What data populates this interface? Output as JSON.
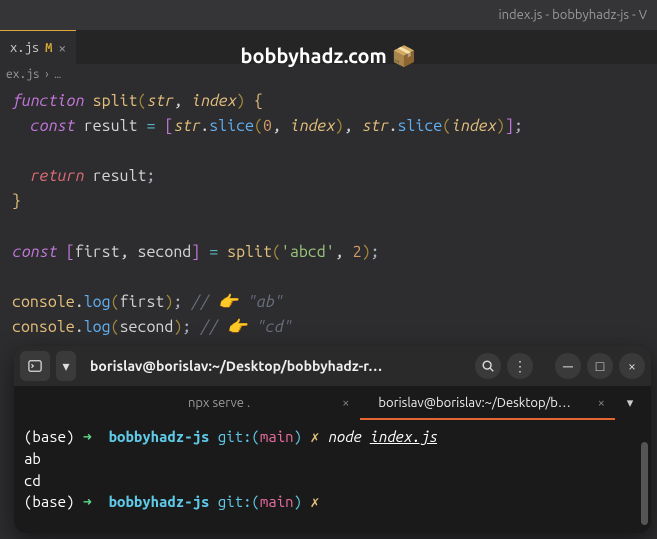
{
  "titlebar": "index.js - bobbyhadz-js - V",
  "watermark": "bobbyhadz.com",
  "editor_tab": {
    "label": "x.js",
    "modified": "M"
  },
  "breadcrumb": {
    "file": "ex.js",
    "sep": "›",
    "more": "…"
  },
  "code": {
    "l1": {
      "fn_kw": "function",
      "name": "split",
      "p1": "str",
      "p2": "index"
    },
    "l2": {
      "const": "const",
      "id": "result",
      "eq": "=",
      "obj": "str",
      "m1": "slice",
      "a0": "0",
      "a1": "index",
      "m2": "slice",
      "a2": "index"
    },
    "l4": {
      "ret": "return",
      "id": "result"
    },
    "l7": {
      "const": "const",
      "d1": "first",
      "d2": "second",
      "eq": "=",
      "fn": "split",
      "s": "'abcd'",
      "n": "2"
    },
    "l9": {
      "obj": "console",
      "m": "log",
      "arg": "first",
      "comment": "// 👉️ \"ab\""
    },
    "l10": {
      "obj": "console",
      "m": "log",
      "arg": "second",
      "comment": "// 👉️ \"cd\""
    }
  },
  "terminal": {
    "title": "borislav@borislav:~/Desktop/bobbyhadz-r…",
    "tabs": {
      "t1": "npx serve .",
      "t2": "borislav@borislav:~/Desktop/b…"
    },
    "prompt": {
      "base": "(base)",
      "arrow": "➜",
      "dir": "bobbyhadz-js",
      "git": "git:(",
      "branch": "main",
      "git_close": ")",
      "x": "✗"
    },
    "cmd": {
      "node": "node",
      "file": "index.js"
    },
    "out1": "ab",
    "out2": "cd"
  }
}
